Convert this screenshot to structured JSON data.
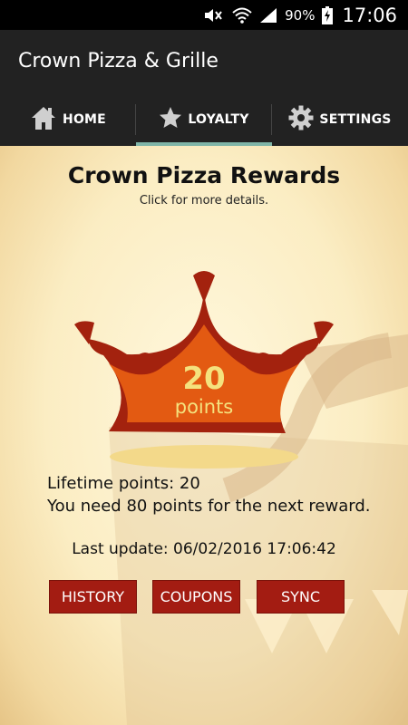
{
  "status_bar": {
    "battery_percent": "90%",
    "time": "17:06",
    "icons": [
      "mute-icon",
      "wifi-icon",
      "signal-icon",
      "battery-icon"
    ]
  },
  "app": {
    "title": "Crown Pizza & Grille"
  },
  "tabs": [
    {
      "label": "HOME",
      "icon": "home-icon",
      "active": false
    },
    {
      "label": "LOYALTY",
      "icon": "star-icon",
      "active": true
    },
    {
      "label": "SETTINGS",
      "icon": "gear-icon",
      "active": false
    }
  ],
  "rewards": {
    "title": "Crown Pizza Rewards",
    "subtitle": "Click for more details.",
    "points_value": "20",
    "points_label": "points",
    "lifetime_text": "Lifetime points: 20",
    "next_reward_text": "You need 80 points for the next reward.",
    "last_update_text": "Last update: 06/02/2016 17:06:42"
  },
  "buttons": {
    "history": "HISTORY",
    "coupons": "COUPONS",
    "sync": "SYNC"
  },
  "colors": {
    "accent_tab": "#7fb5a8",
    "button_red": "#a31c12",
    "crown_dark": "#a3220e",
    "crown_orange": "#e35a12",
    "points_yellow": "#f4e27e"
  }
}
